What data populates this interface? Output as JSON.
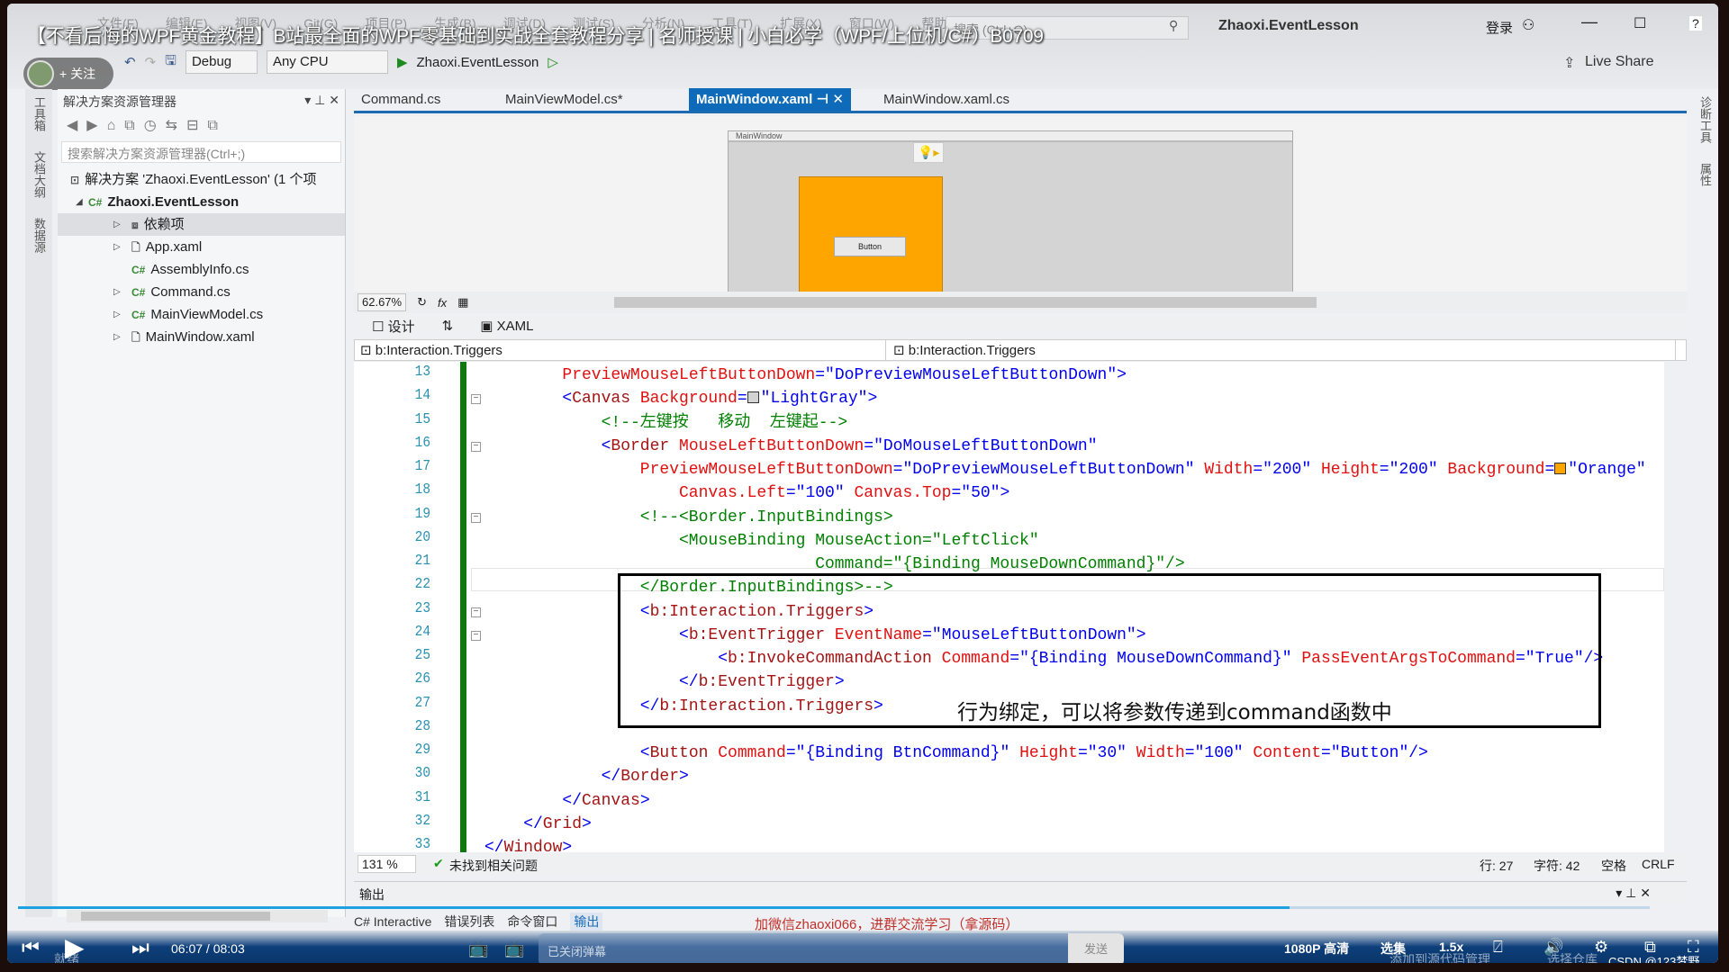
{
  "video_title": "【不看后悔的WPF黄金教程】B站最全面的WPF零基础到实战全套教程分享 | 名师授课 | 小白必学（WPF/上位机/C#）B0709",
  "follow_label": "+ 关注",
  "menu": [
    "文件(F)",
    "编辑(E)",
    "视图(V)",
    "Git(G)",
    "项目(P)",
    "生成(B)",
    "调试(D)",
    "测试(S)",
    "分析(N)",
    "工具(T)",
    "扩展(X)",
    "窗口(W)",
    "帮助(H)"
  ],
  "search_placeholder": "搜索 (Ctrl+Q)",
  "app_title": "Zhaoxi.EventLesson",
  "login_label": "登录",
  "toolbar": {
    "config": "Debug",
    "platform": "Any CPU",
    "run_target": "Zhaoxi.EventLesson",
    "live_share": "Live Share"
  },
  "left_strip": [
    "工具箱",
    "文档大纲",
    "数据源"
  ],
  "right_strip": [
    "诊断工具",
    "属性"
  ],
  "solution_explorer": {
    "title": "解决方案资源管理器",
    "search_placeholder": "搜索解决方案资源管理器(Ctrl+;)",
    "items": [
      {
        "label": "解决方案 'Zhaoxi.EventLesson' (1 个项",
        "icon": "solution-icon"
      },
      {
        "label": "Zhaoxi.EventLesson",
        "icon": "csharp-project-icon"
      },
      {
        "label": "依赖项",
        "icon": "dependencies-icon"
      },
      {
        "label": "App.xaml",
        "icon": "xaml-file-icon"
      },
      {
        "label": "AssemblyInfo.cs",
        "icon": "csharp-file-icon"
      },
      {
        "label": "Command.cs",
        "icon": "csharp-file-icon"
      },
      {
        "label": "MainViewModel.cs",
        "icon": "csharp-file-icon"
      },
      {
        "label": "MainWindow.xaml",
        "icon": "xaml-file-icon"
      }
    ]
  },
  "tabs": [
    {
      "label": "Command.cs",
      "active": false
    },
    {
      "label": "MainViewModel.cs*",
      "active": false
    },
    {
      "label": "MainWindow.xaml",
      "active": true
    },
    {
      "label": "MainWindow.xaml.cs",
      "active": false
    }
  ],
  "designer": {
    "window_title": "MainWindow",
    "button_label": "Button",
    "zoom": "62.67%",
    "border_color": "#FFA500"
  },
  "view_tabs": {
    "design": "设计",
    "xaml": "XAML"
  },
  "nav": {
    "left": "b:Interaction.Triggers",
    "right": "b:Interaction.Triggers"
  },
  "code": [
    {
      "num": "13",
      "indent": 8,
      "tokens": [
        [
          "PreviewMouseLeftButtonDown",
          "attr"
        ],
        [
          "=\"",
          "pun"
        ],
        [
          "DoPreviewMouseLeftButtonDown",
          "val"
        ],
        [
          "\">",
          "pun"
        ]
      ]
    },
    {
      "num": "14",
      "indent": 8,
      "fold": true,
      "tokens": [
        [
          "<",
          "pun"
        ],
        [
          "Canvas",
          "tag"
        ],
        [
          " Background",
          "attr"
        ],
        [
          "=",
          "pun"
        ],
        [
          "#D3D3D3",
          "swatch"
        ],
        [
          "\"LightGray\">",
          "val"
        ]
      ]
    },
    {
      "num": "15",
      "indent": 12,
      "tokens": [
        [
          "<!--左键按   移动  左键起-->",
          "com"
        ]
      ]
    },
    {
      "num": "16",
      "indent": 12,
      "fold": true,
      "tokens": [
        [
          "<",
          "pun"
        ],
        [
          "Border",
          "tag"
        ],
        [
          " MouseLeftButtonDown",
          "attr"
        ],
        [
          "=\"",
          "pun"
        ],
        [
          "DoMouseLeftButtonDown",
          "val"
        ],
        [
          "\"",
          "pun"
        ]
      ]
    },
    {
      "num": "17",
      "indent": 16,
      "tokens": [
        [
          "PreviewMouseLeftButtonDown",
          "attr"
        ],
        [
          "=\"",
          "pun"
        ],
        [
          "DoPreviewMouseLeftButtonDown",
          "val"
        ],
        [
          "\"",
          "pun"
        ],
        [
          " Width",
          "attr"
        ],
        [
          "=\"",
          "pun"
        ],
        [
          "200",
          "val"
        ],
        [
          "\"",
          "pun"
        ],
        [
          " Height",
          "attr"
        ],
        [
          "=\"",
          "pun"
        ],
        [
          "200",
          "val"
        ],
        [
          "\"",
          "pun"
        ],
        [
          " Background",
          "attr"
        ],
        [
          "=",
          "pun"
        ],
        [
          "#FFA500",
          "swatch"
        ],
        [
          "\"Orange\"",
          "val"
        ]
      ]
    },
    {
      "num": "18",
      "indent": 20,
      "tokens": [
        [
          "Canvas.Left",
          "attr"
        ],
        [
          "=\"",
          "pun"
        ],
        [
          "100",
          "val"
        ],
        [
          "\"",
          "pun"
        ],
        [
          " Canvas.Top",
          "attr"
        ],
        [
          "=\"",
          "pun"
        ],
        [
          "50",
          "val"
        ],
        [
          "\">",
          "pun"
        ]
      ]
    },
    {
      "num": "19",
      "indent": 16,
      "fold": true,
      "tokens": [
        [
          "<!--<Border.InputBindings>",
          "com"
        ]
      ]
    },
    {
      "num": "20",
      "indent": 20,
      "tokens": [
        [
          "<MouseBinding MouseAction=\"LeftClick\"",
          "com"
        ]
      ]
    },
    {
      "num": "21",
      "indent": 34,
      "tokens": [
        [
          "Command=\"{Binding MouseDownCommand}\"/>",
          "com"
        ]
      ]
    },
    {
      "num": "22",
      "indent": 16,
      "tokens": [
        [
          "</Border.InputBindings>-->",
          "com"
        ]
      ]
    },
    {
      "num": "23",
      "indent": 16,
      "fold": true,
      "tokens": [
        [
          "<",
          "pun"
        ],
        [
          "b:Interaction.Triggers",
          "tag"
        ],
        [
          ">",
          "pun"
        ]
      ]
    },
    {
      "num": "24",
      "indent": 20,
      "fold": true,
      "tokens": [
        [
          "<",
          "pun"
        ],
        [
          "b:EventTrigger",
          "tag"
        ],
        [
          " EventName",
          "attr"
        ],
        [
          "=\"",
          "pun"
        ],
        [
          "MouseLeftButtonDown",
          "val"
        ],
        [
          "\">",
          "pun"
        ]
      ]
    },
    {
      "num": "25",
      "indent": 24,
      "tokens": [
        [
          "<",
          "pun"
        ],
        [
          "b:InvokeCommandAction",
          "tag"
        ],
        [
          " Command",
          "attr"
        ],
        [
          "=\"",
          "pun"
        ],
        [
          "{Binding MouseDownCommand}",
          "val"
        ],
        [
          "\"",
          "pun"
        ],
        [
          " PassEventArgsToCommand",
          "attr"
        ],
        [
          "=\"",
          "pun"
        ],
        [
          "True",
          "val"
        ],
        [
          "\"/>",
          "pun"
        ]
      ]
    },
    {
      "num": "26",
      "indent": 20,
      "tokens": [
        [
          "</",
          "pun"
        ],
        [
          "b:EventTrigger",
          "tag"
        ],
        [
          ">",
          "pun"
        ]
      ]
    },
    {
      "num": "27",
      "indent": 16,
      "tokens": [
        [
          "</",
          "pun"
        ],
        [
          "b:Interaction.Triggers",
          "tag"
        ],
        [
          ">",
          "pun"
        ]
      ]
    },
    {
      "num": "28",
      "indent": 0,
      "tokens": []
    },
    {
      "num": "29",
      "indent": 16,
      "tokens": [
        [
          "<",
          "pun"
        ],
        [
          "Button",
          "tag"
        ],
        [
          " Command",
          "attr"
        ],
        [
          "=\"",
          "pun"
        ],
        [
          "{Binding BtnCommand}",
          "val"
        ],
        [
          "\"",
          "pun"
        ],
        [
          " Height",
          "attr"
        ],
        [
          "=\"",
          "pun"
        ],
        [
          "30",
          "val"
        ],
        [
          "\"",
          "pun"
        ],
        [
          " Width",
          "attr"
        ],
        [
          "=\"",
          "pun"
        ],
        [
          "100",
          "val"
        ],
        [
          "\"",
          "pun"
        ],
        [
          " Content",
          "attr"
        ],
        [
          "=\"",
          "pun"
        ],
        [
          "Button",
          "val"
        ],
        [
          "\"/>",
          "pun"
        ]
      ]
    },
    {
      "num": "30",
      "indent": 12,
      "tokens": [
        [
          "</",
          "pun"
        ],
        [
          "Border",
          "tag"
        ],
        [
          ">",
          "pun"
        ]
      ]
    },
    {
      "num": "31",
      "indent": 8,
      "tokens": [
        [
          "</",
          "pun"
        ],
        [
          "Canvas",
          "tag"
        ],
        [
          ">",
          "pun"
        ]
      ]
    },
    {
      "num": "32",
      "indent": 4,
      "tokens": [
        [
          "</",
          "pun"
        ],
        [
          "Grid",
          "tag"
        ],
        [
          ">",
          "pun"
        ]
      ]
    },
    {
      "num": "33",
      "indent": 0,
      "tokens": [
        [
          "</",
          "pun"
        ],
        [
          "Window",
          "tag"
        ],
        [
          ">",
          "pun"
        ]
      ]
    }
  ],
  "annotation": "行为绑定，可以将参数传递到command函数中",
  "editor_status": {
    "zoom": "131 %",
    "issues": "未找到相关问题",
    "line": "行: 27",
    "char": "字符: 42",
    "spacing": "空格",
    "eol": "CRLF"
  },
  "output_title": "输出",
  "bottom_tabs": [
    "C# Interactive",
    "错误列表",
    "命令窗口",
    "输出"
  ],
  "notice": "加微信zhaoxi066，进群交流学习（拿源码）",
  "player": {
    "time": "06:07 / 08:03",
    "progress": 0.763,
    "danmaku_placeholder": "已关闭弹幕",
    "send": "发送",
    "quality": "1080P 高清",
    "episodes": "选集",
    "speed": "1.5x"
  },
  "status_ready": "就绪",
  "source_control": "添加到源代码管理",
  "repo": "选择仓库",
  "watermark": "CSDN @123梦野"
}
